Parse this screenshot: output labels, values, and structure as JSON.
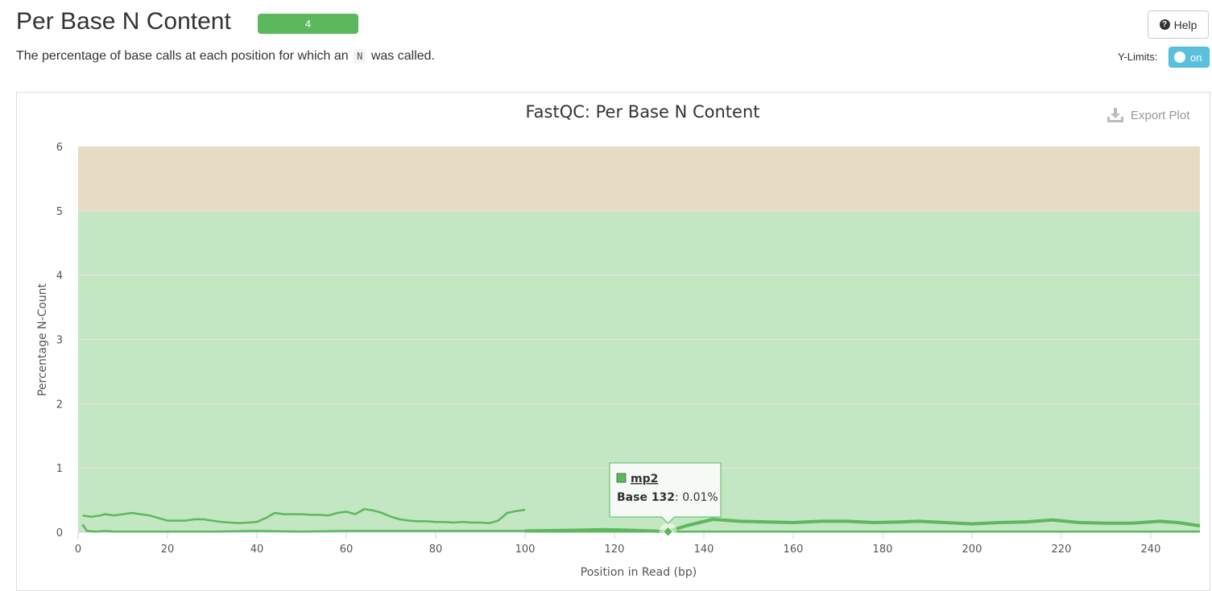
{
  "header": {
    "title": "Per Base N Content",
    "badge": "4",
    "description_pre": "The percentage of base calls at each position for which an",
    "description_code": "N",
    "description_post": "was called.",
    "help_label": "Help",
    "ylimits_label": "Y-Limits:",
    "ylimits_toggle": "on"
  },
  "export_label": "Export Plot",
  "colors": {
    "pass_band": "#c3e6c3",
    "warn_band": "#e6dcc3",
    "series": "#5cb85c",
    "badge": "#5cb85c",
    "toggle": "#5bc0de"
  },
  "tooltip": {
    "series": "mp2",
    "label": "Base 132",
    "value": ": 0.01%"
  },
  "chart_data": {
    "type": "line",
    "title": "FastQC: Per Base N Content",
    "xlabel": "Position in Read (bp)",
    "ylabel": "Percentage N-Count",
    "xlim": [
      0,
      251
    ],
    "ylim": [
      0,
      6
    ],
    "xticks": [
      "0",
      "20",
      "40",
      "60",
      "80",
      "100",
      "120",
      "140",
      "160",
      "180",
      "200",
      "220",
      "240"
    ],
    "yticks": [
      "0",
      "1",
      "2",
      "3",
      "4",
      "5",
      "6"
    ],
    "bands": [
      {
        "from": 0,
        "to": 5,
        "status": "pass"
      },
      {
        "from": 5,
        "to": 6,
        "status": "warn"
      }
    ],
    "grid": true,
    "series": [
      {
        "name": "",
        "x": [
          1,
          3,
          5,
          6,
          8,
          10,
          12,
          14,
          16,
          18,
          20,
          22,
          24,
          26,
          28,
          30,
          32,
          34,
          36,
          38,
          40,
          42,
          44,
          46,
          48,
          50,
          52,
          54,
          56,
          58,
          60,
          62,
          64,
          66,
          68,
          70,
          72,
          74,
          76,
          78,
          80,
          82,
          84,
          86,
          88,
          90,
          92,
          94,
          96,
          98,
          100
        ],
        "y": [
          0.26,
          0.24,
          0.26,
          0.28,
          0.26,
          0.28,
          0.3,
          0.28,
          0.26,
          0.22,
          0.18,
          0.18,
          0.18,
          0.2,
          0.2,
          0.18,
          0.16,
          0.15,
          0.14,
          0.15,
          0.16,
          0.22,
          0.3,
          0.28,
          0.28,
          0.28,
          0.27,
          0.27,
          0.26,
          0.3,
          0.32,
          0.28,
          0.36,
          0.34,
          0.3,
          0.24,
          0.2,
          0.18,
          0.17,
          0.17,
          0.16,
          0.16,
          0.15,
          0.16,
          0.15,
          0.15,
          0.14,
          0.18,
          0.3,
          0.33,
          0.35
        ]
      },
      {
        "name": "",
        "x": [
          1,
          2,
          4,
          6,
          8,
          10,
          15,
          20,
          30,
          40,
          50,
          60,
          70,
          80,
          90,
          100
        ],
        "y": [
          0.12,
          0.02,
          0.01,
          0.02,
          0.01,
          0.01,
          0.01,
          0.01,
          0.01,
          0.02,
          0.01,
          0.02,
          0.02,
          0.02,
          0.02,
          0.02
        ]
      },
      {
        "name": "mp2",
        "x": [
          100,
          110,
          118,
          124,
          128,
          132,
          136,
          142,
          148,
          154,
          160,
          166,
          172,
          178,
          184,
          188,
          194,
          200,
          206,
          212,
          218,
          224,
          230,
          236,
          242,
          246,
          251
        ],
        "y": [
          0.02,
          0.03,
          0.04,
          0.03,
          0.02,
          0.01,
          0.1,
          0.2,
          0.17,
          0.16,
          0.15,
          0.17,
          0.17,
          0.15,
          0.16,
          0.17,
          0.15,
          0.13,
          0.15,
          0.16,
          0.19,
          0.15,
          0.14,
          0.14,
          0.17,
          0.15,
          0.1
        ]
      },
      {
        "name": "",
        "x": [
          100,
          140,
          180,
          220,
          251
        ],
        "y": [
          0.01,
          0.01,
          0.01,
          0.01,
          0.01
        ]
      }
    ]
  }
}
